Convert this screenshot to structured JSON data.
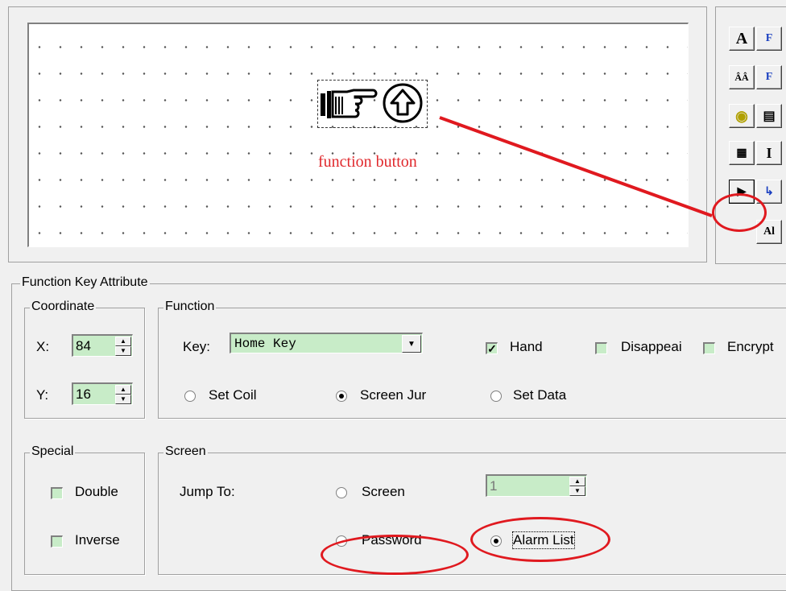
{
  "canvas": {
    "button_label": "function button"
  },
  "toolbox": {
    "buttons": [
      "A",
      "F",
      "ÂÂ",
      "F",
      "◉",
      "▤",
      "▦",
      "I",
      "▶",
      "↳",
      "Al"
    ]
  },
  "attr": {
    "title": "Function Key Attribute",
    "coordinate": {
      "title": "Coordinate",
      "x_label": "X:",
      "x_value": "84",
      "y_label": "Y:",
      "y_value": "16"
    },
    "function": {
      "title": "Function",
      "key_label": "Key:",
      "key_value": "Home Key",
      "hand": "Hand",
      "hand_checked": true,
      "disappear": "Disappeai",
      "encrypt": "Encrypt",
      "set_coil": "Set Coil",
      "screen_jump": "Screen Jur",
      "set_data": "Set Data"
    },
    "special": {
      "title": "Special",
      "double": "Double",
      "inverse": "Inverse"
    },
    "screen": {
      "title": "Screen",
      "jump_to": "Jump To:",
      "screen": "Screen",
      "screen_value": "1",
      "password": "Password",
      "alarm_list": "Alarm List"
    }
  },
  "colors": {
    "annotation": "#e0191f",
    "field": "#c8ecc8"
  }
}
